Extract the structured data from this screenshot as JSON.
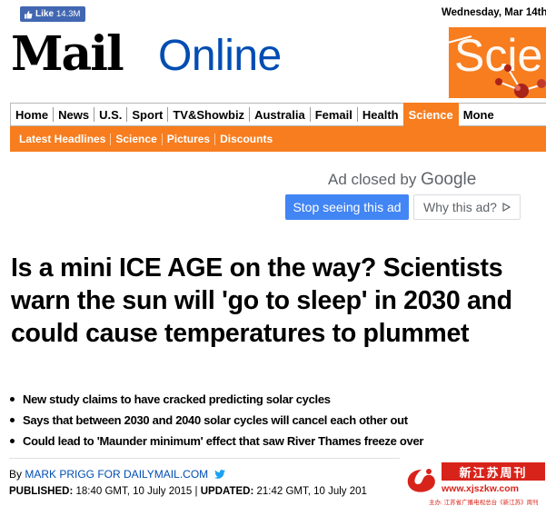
{
  "top_bar": {
    "fb_like_label": "Like",
    "fb_like_count": "14.3M",
    "date": "Wednesday, Mar 14th"
  },
  "masthead": {
    "logo_mail": "Mail",
    "logo_online": "Online",
    "section_banner": "Scie"
  },
  "nav": {
    "items": [
      {
        "label": "Home"
      },
      {
        "label": "News"
      },
      {
        "label": "U.S."
      },
      {
        "label": "Sport"
      },
      {
        "label": "TV&Showbiz"
      },
      {
        "label": "Australia"
      },
      {
        "label": "Femail"
      },
      {
        "label": "Health"
      },
      {
        "label": "Science"
      },
      {
        "label": "Mone"
      }
    ],
    "active": "Science"
  },
  "subnav": {
    "items": [
      {
        "label": "Latest Headlines"
      },
      {
        "label": "Science"
      },
      {
        "label": "Pictures"
      },
      {
        "label": "Discounts"
      }
    ]
  },
  "ad": {
    "closed_text": "Ad closed by ",
    "closed_brand": "Google",
    "stop_button": "Stop seeing this ad",
    "why_button": "Why this ad?",
    "why_icon": "play-triangle-icon"
  },
  "article": {
    "headline": "Is a mini ICE AGE on the way? Scientists warn the sun will 'go to sleep' in 2030 and could cause temperatures to plummet",
    "bullets": [
      "New study claims to have cracked predicting solar cycles",
      "Says that between 2030 and 2040 solar cycles will cancel each other out",
      "Could lead to 'Maunder minimum' effect that saw River Thames freeze over"
    ],
    "byline_prefix": "By ",
    "byline_author": "MARK PRIGG FOR DAILYMAIL.COM",
    "published_label": "PUBLISHED:",
    "published_value": " 18:40 GMT, 10 July 2015 | ",
    "updated_label": "UPDATED:",
    "updated_value": " 21:42 GMT, 10 July 201"
  },
  "watermark": {
    "title": "新江苏周刊",
    "url": "www.xjszkw.com",
    "sub": "主办: 江苏省广播电视总台《新江苏》周刊"
  },
  "colors": {
    "accent_orange": "#f77d1f",
    "online_blue": "#004db3",
    "google_button_blue": "#4285f4",
    "facebook_blue": "#4267b2",
    "watermark_red": "#d8231b"
  }
}
